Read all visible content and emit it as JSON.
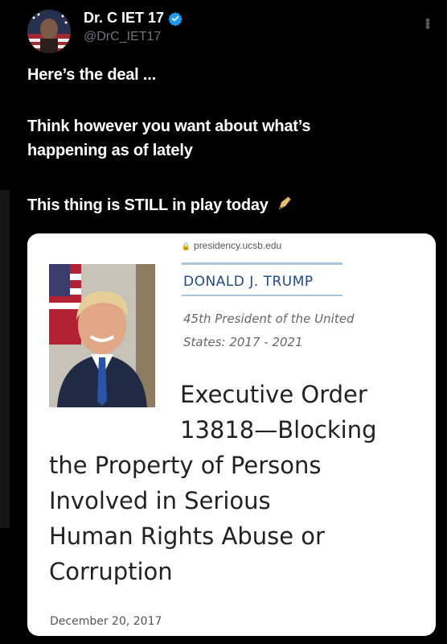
{
  "author": {
    "display_name": "Dr. C IET 17",
    "handle": "@DrC_IET17",
    "verified": true
  },
  "tweet": {
    "lines": [
      "Here’s the deal ...",
      "Think however you want about what’s",
      "happening as of lately",
      "This thing is STILL in play today"
    ],
    "emoji": "pen-icon"
  },
  "card": {
    "url": "presidency.ucsb.edu",
    "president_name": "DONALD J. TRUMP",
    "president_title": [
      "45th President of the United",
      "States: 2017 - 2021"
    ],
    "title_lines": [
      "Executive Order",
      "13818—Blocking",
      "the Property of Persons",
      "Involved in Serious",
      "Human Rights Abuse or",
      "Corruption"
    ],
    "date": "December 20, 2017"
  },
  "colors": {
    "background": "#000000",
    "verified_badge": "#1d9bf0",
    "link_blue": "#1f4a86"
  }
}
